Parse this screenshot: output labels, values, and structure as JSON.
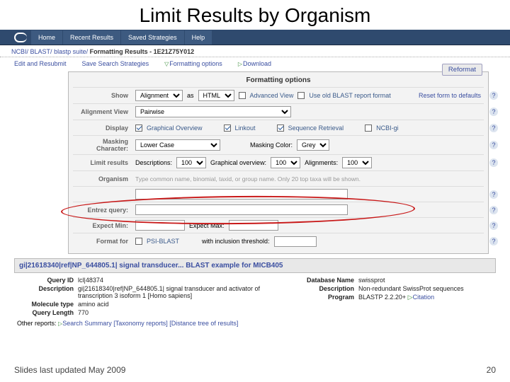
{
  "slide": {
    "title": "Limit Results by Organism",
    "footer_left": "Slides last updated May 2009",
    "footer_right": "20"
  },
  "nav": {
    "home": "Home",
    "recent": "Recent Results",
    "saved": "Saved Strategies",
    "help": "Help"
  },
  "bc": {
    "ncbi": "NCBI/",
    "blast": "BLAST/",
    "suite": "blastp suite/",
    "fmt": "Formatting Results",
    "rid": "- 1E21Z75Y012"
  },
  "linkbar": {
    "edit": "Edit and Resubmit",
    "save": "Save Search Strategies",
    "fmt": "Formatting options",
    "dl": "Download"
  },
  "panel": {
    "title": "Formatting options",
    "reformat": "Reformat",
    "reset": "Reset form to defaults",
    "show": {
      "label": "Show",
      "sel1": "Alignment",
      "as": "as",
      "sel2": "HTML",
      "adv": "Advanced View",
      "old": "Use old BLAST report format"
    },
    "aln": {
      "label": "Alignment View",
      "sel": "Pairwise"
    },
    "disp": {
      "label": "Display",
      "go": "Graphical Overview",
      "lo": "Linkout",
      "sr": "Sequence Retrieval",
      "ng": "NCBI-gi"
    },
    "mask": {
      "label": "Masking Character:",
      "sel": "Lower Case",
      "color_label": "Masking Color:",
      "color": "Grey"
    },
    "limit": {
      "label": "Limit results",
      "desc_l": "Descriptions:",
      "desc": "100",
      "go_l": "Graphical overview:",
      "go": "100",
      "al_l": "Alignments:",
      "al": "100"
    },
    "org": {
      "label": "Organism",
      "hint": "Type common name, binomial, taxid, or group name. Only 20 top taxa will be shown."
    },
    "entrez": {
      "label": "Entrez query:"
    },
    "expect": {
      "min_l": "Expect Min:",
      "max_l": "Expect Max:"
    },
    "fmt": {
      "label": "Format for",
      "psi": "PSI-BLAST",
      "thr_l": "with inclusion threshold:"
    }
  },
  "query": {
    "heading": "gi|21618340|ref|NP_644805.1| signal transducer... BLAST example for MICB405",
    "qid_l": "Query ID",
    "qid": "lcl|48374",
    "desc_l": "Description",
    "desc": "gi|21618340|ref|NP_644805.1| signal transducer and activator of transcription 3 isoform 1 [Homo sapiens]",
    "mol_l": "Molecule type",
    "mol": "amino acid",
    "len_l": "Query Length",
    "len": "770",
    "db_l": "Database Name",
    "db": "swissprot",
    "ddesc_l": "Description",
    "ddesc": "Non-redundant SwissProt sequences",
    "prog_l": "Program",
    "prog": "BLASTP 2.2.20+",
    "cit": "Citation"
  },
  "other": {
    "label": "Other reports:",
    "search": "Search Summary",
    "tax": "[Taxonomy reports]",
    "dist": "[Distance tree of results]"
  }
}
